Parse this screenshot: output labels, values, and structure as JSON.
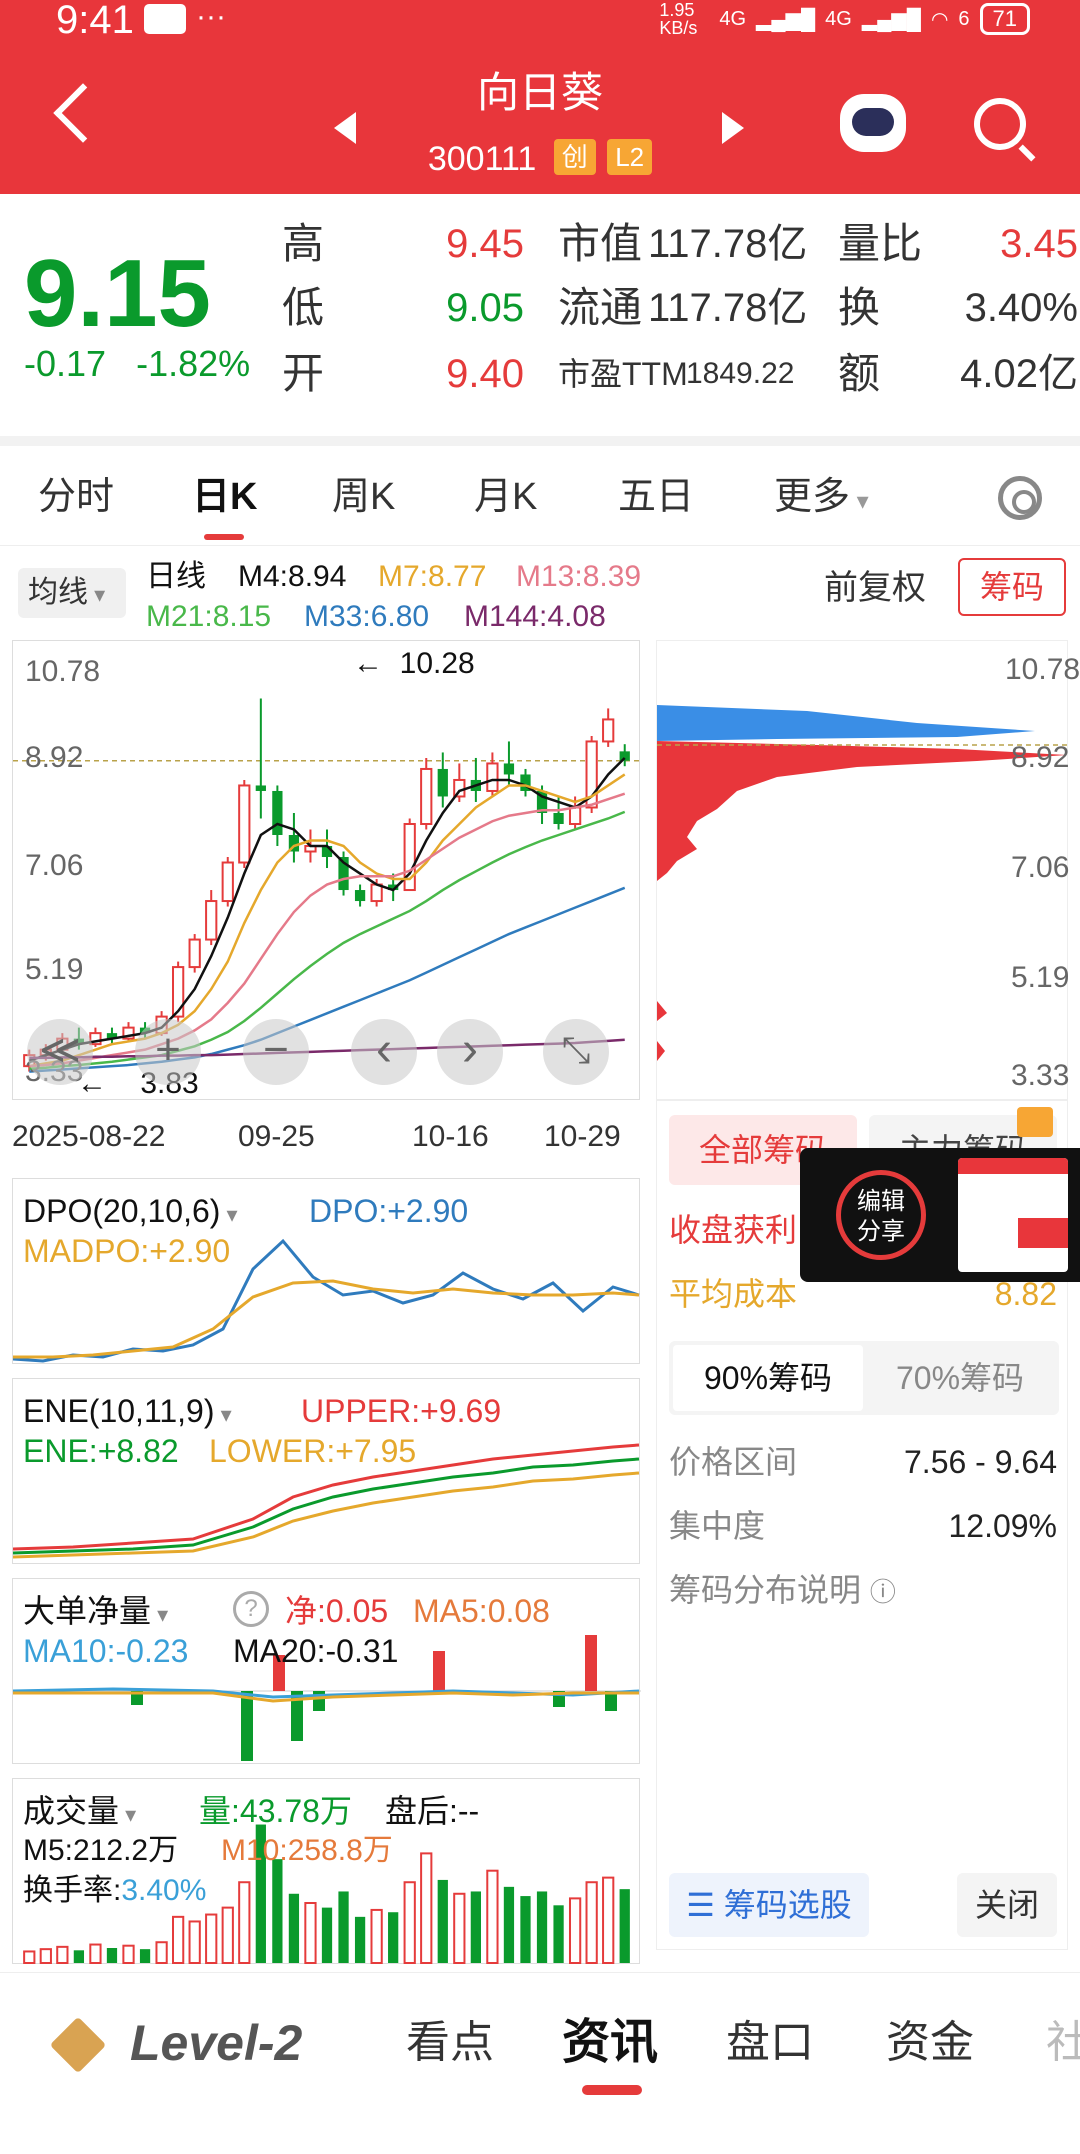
{
  "status": {
    "time": "9:41",
    "dots": "···",
    "speed": "1.95 KB/s",
    "net1": "4G",
    "net2": "4G",
    "wifi_badge": "6",
    "battery": "71"
  },
  "header": {
    "title": "向日葵",
    "code": "300111",
    "tag1": "创",
    "tag2": "L2"
  },
  "quote": {
    "price": "9.15",
    "change": "-0.17",
    "change_pct": "-1.82%",
    "high_label": "高",
    "high": "9.45",
    "low_label": "低",
    "low": "9.05",
    "open_label": "开",
    "open": "9.40",
    "mcap_label": "市值",
    "mcap": "117.78亿",
    "float_label": "流通",
    "float": "117.78亿",
    "pe_label": "市盈TTM",
    "pe": "1849.22",
    "volratio_label": "量比",
    "volratio": "3.45",
    "turnover_label": "换",
    "turnover": "3.40%",
    "amount_label": "额",
    "amount": "4.02亿"
  },
  "tabs": [
    "分时",
    "日K",
    "周K",
    "月K",
    "五日",
    "更多"
  ],
  "ma": {
    "select": "均线",
    "period": "日线",
    "m4": "M4:8.94",
    "m7": "M7:8.77",
    "m13": "M13:8.39",
    "m21": "M21:8.15",
    "m33": "M33:6.80",
    "m144": "M144:4.08",
    "adjust": "前复权",
    "chip_button": "筹码"
  },
  "colors": {
    "up": "#e53b3b",
    "down": "#0a9a2c",
    "m4": "#111111",
    "m7": "#e5a82c",
    "m13": "#e57a8a",
    "m21": "#49b84a",
    "m33": "#2f7bbd",
    "m144": "#7a2a6a"
  },
  "kchart": {
    "y_ticks": [
      "10.78",
      "8.92",
      "7.06",
      "5.19",
      "3.33"
    ],
    "x_ticks": [
      "2025-08-22",
      "09-25",
      "10-16",
      "10-29"
    ],
    "max_note": "10.28",
    "min_note": "3.83"
  },
  "chart_data": {
    "type": "candlestick",
    "ylim": [
      3.33,
      10.78
    ],
    "candles": [
      [
        3.6,
        3.8,
        3.5,
        3.9
      ],
      [
        3.8,
        3.9,
        3.7,
        4.0
      ],
      [
        3.9,
        4.1,
        3.85,
        4.2
      ],
      [
        4.1,
        4.0,
        3.9,
        4.3
      ],
      [
        4.0,
        4.2,
        3.95,
        4.3
      ],
      [
        4.2,
        4.1,
        4.0,
        4.3
      ],
      [
        4.1,
        4.3,
        4.05,
        4.4
      ],
      [
        4.3,
        4.2,
        4.1,
        4.4
      ],
      [
        4.2,
        4.5,
        4.15,
        4.6
      ],
      [
        4.5,
        5.4,
        4.4,
        5.5
      ],
      [
        5.4,
        5.9,
        5.3,
        6.0
      ],
      [
        5.9,
        6.6,
        5.8,
        6.8
      ],
      [
        6.6,
        7.3,
        6.5,
        7.4
      ],
      [
        7.3,
        8.7,
        7.2,
        8.8
      ],
      [
        8.7,
        8.6,
        8.1,
        10.28
      ],
      [
        8.6,
        7.8,
        7.6,
        8.7
      ],
      [
        7.8,
        7.5,
        7.3,
        8.2
      ],
      [
        7.5,
        7.6,
        7.3,
        7.9
      ],
      [
        7.6,
        7.4,
        7.2,
        7.9
      ],
      [
        7.4,
        6.8,
        6.7,
        7.5
      ],
      [
        6.8,
        6.6,
        6.5,
        6.9
      ],
      [
        6.6,
        6.9,
        6.5,
        7.0
      ],
      [
        6.9,
        6.8,
        6.6,
        7.1
      ],
      [
        6.8,
        8.0,
        6.8,
        8.1
      ],
      [
        8.0,
        9.0,
        7.9,
        9.2
      ],
      [
        9.0,
        8.5,
        8.3,
        9.3
      ],
      [
        8.5,
        8.8,
        8.4,
        9.1
      ],
      [
        8.8,
        8.6,
        8.4,
        9.2
      ],
      [
        8.6,
        9.1,
        8.5,
        9.3
      ],
      [
        9.1,
        8.9,
        8.7,
        9.5
      ],
      [
        8.9,
        8.6,
        8.5,
        9.0
      ],
      [
        8.6,
        8.2,
        8.0,
        8.7
      ],
      [
        8.2,
        8.0,
        7.9,
        8.5
      ],
      [
        8.0,
        8.3,
        7.9,
        8.5
      ],
      [
        8.3,
        9.5,
        8.2,
        9.6
      ],
      [
        9.5,
        9.9,
        9.4,
        10.1
      ],
      [
        9.32,
        9.15,
        9.05,
        9.45
      ]
    ],
    "ma": {
      "M4": [
        3.7,
        3.8,
        3.9,
        4.0,
        4.05,
        4.1,
        4.15,
        4.2,
        4.3,
        4.6,
        5.0,
        5.6,
        6.3,
        7.1,
        7.8,
        8.0,
        7.9,
        7.6,
        7.6,
        7.3,
        7.1,
        6.9,
        6.8,
        7.1,
        7.7,
        8.2,
        8.6,
        8.7,
        8.8,
        8.8,
        8.7,
        8.5,
        8.4,
        8.3,
        8.5,
        8.9,
        9.2
      ],
      "M7": [
        3.6,
        3.65,
        3.7,
        3.8,
        3.9,
        4.0,
        4.05,
        4.1,
        4.2,
        4.35,
        4.6,
        5.0,
        5.5,
        6.2,
        6.8,
        7.3,
        7.6,
        7.7,
        7.7,
        7.6,
        7.3,
        7.1,
        7.0,
        7.0,
        7.3,
        7.7,
        8.0,
        8.3,
        8.5,
        8.7,
        8.7,
        8.6,
        8.5,
        8.4,
        8.5,
        8.7,
        8.9
      ],
      "M13": [
        3.6,
        3.62,
        3.65,
        3.7,
        3.75,
        3.8,
        3.85,
        3.9,
        4.0,
        4.1,
        4.25,
        4.45,
        4.75,
        5.1,
        5.55,
        6.0,
        6.4,
        6.7,
        6.9,
        7.0,
        7.05,
        7.05,
        7.05,
        7.15,
        7.35,
        7.55,
        7.75,
        7.9,
        8.05,
        8.15,
        8.2,
        8.25,
        8.25,
        8.3,
        8.35,
        8.45,
        8.55
      ],
      "M21": [
        3.55,
        3.57,
        3.6,
        3.62,
        3.65,
        3.68,
        3.72,
        3.76,
        3.8,
        3.88,
        3.96,
        4.08,
        4.22,
        4.42,
        4.66,
        4.92,
        5.18,
        5.42,
        5.64,
        5.84,
        6.0,
        6.14,
        6.28,
        6.42,
        6.6,
        6.8,
        6.98,
        7.14,
        7.3,
        7.45,
        7.58,
        7.7,
        7.8,
        7.9,
        8.0,
        8.1,
        8.22
      ],
      "M33": [
        3.5,
        3.52,
        3.54,
        3.56,
        3.58,
        3.6,
        3.62,
        3.65,
        3.68,
        3.72,
        3.76,
        3.82,
        3.9,
        3.98,
        4.08,
        4.2,
        4.32,
        4.44,
        4.56,
        4.68,
        4.8,
        4.92,
        5.04,
        5.16,
        5.3,
        5.44,
        5.58,
        5.72,
        5.86,
        6.0,
        6.12,
        6.24,
        6.36,
        6.48,
        6.6,
        6.72,
        6.84
      ],
      "M144": [
        3.75,
        3.75,
        3.76,
        3.76,
        3.77,
        3.77,
        3.78,
        3.78,
        3.79,
        3.79,
        3.8,
        3.8,
        3.81,
        3.82,
        3.83,
        3.84,
        3.85,
        3.86,
        3.87,
        3.88,
        3.89,
        3.9,
        3.91,
        3.92,
        3.93,
        3.94,
        3.95,
        3.96,
        3.97,
        3.98,
        3.99,
        4.0,
        4.01,
        4.02,
        4.04,
        4.06,
        4.08
      ]
    }
  },
  "chart_controls": {
    "prev_all": "≪",
    "zoom_in": "+",
    "zoom_out": "−",
    "prev": "‹",
    "next": "›",
    "reset": "⤡"
  },
  "dpo": {
    "select": "DPO(20,10,6)",
    "dpo": "DPO:+2.90",
    "madpo": "MADPO:+2.90"
  },
  "ene": {
    "select": "ENE(10,11,9)",
    "upper": "UPPER:+9.69",
    "ene": "ENE:+8.82",
    "lower": "LOWER:+7.95"
  },
  "bigorder": {
    "select": "大单净量",
    "net": "净:0.05",
    "ma5": "MA5:0.08",
    "ma10": "MA10:-0.23",
    "ma20": "MA20:-0.31"
  },
  "volume": {
    "select": "成交量",
    "vol": "量:43.78万",
    "after": "盘后:--",
    "m5": "M5:212.2万",
    "m10": "M10:258.8万",
    "turn_label": "换手率:",
    "turn": "3.40%"
  },
  "chip": {
    "y_ticks": [
      "10.78",
      "8.92",
      "7.06",
      "5.19",
      "3.33"
    ],
    "tab_all": "全部筹码",
    "tab_main": "主力筹码",
    "profit_label": "收盘获利",
    "avg_label": "平均成本",
    "avg_value": "8.82",
    "seg90": "90%筹码",
    "seg70": "70%筹码",
    "range_label": "价格区间",
    "range_value": "7.56 - 9.64",
    "conc_label": "集中度",
    "conc_value": "12.09%",
    "explain": "筹码分布说明",
    "select_btn": "筹码选股",
    "close_btn": "关闭"
  },
  "share_popup": {
    "line1": "编辑",
    "line2": "分享"
  },
  "bottom_nav": [
    "Level-2",
    "看点",
    "资讯",
    "盘口",
    "资金",
    "社"
  ]
}
